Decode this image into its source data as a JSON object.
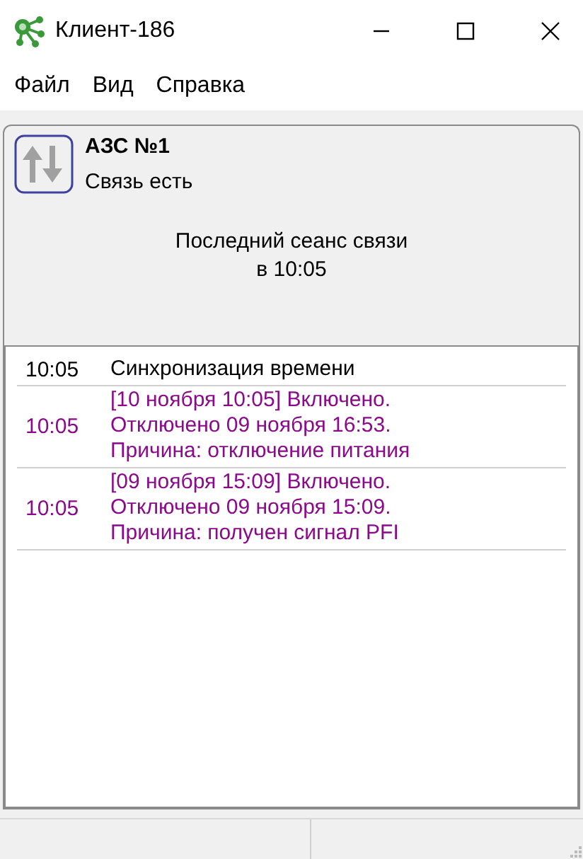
{
  "window": {
    "title": "Клиент-186"
  },
  "menu": [
    {
      "label": "Файл"
    },
    {
      "label": "Вид"
    },
    {
      "label": "Справка"
    }
  ],
  "station": {
    "name": "АЗС №1",
    "status": "Связь есть",
    "last_session": [
      "Последний сеанс связи",
      "в 10:05"
    ]
  },
  "log": [
    {
      "time": "10:05",
      "lines": [
        "Синхронизация времени"
      ],
      "color": "#000000"
    },
    {
      "time": "10:05",
      "lines": [
        "[10 ноября 10:05] Включено.",
        "Отключено 09 ноября 16:53.",
        "Причина: отключение питания"
      ],
      "color": "#8b0a8b"
    },
    {
      "time": "10:05",
      "lines": [
        "[09 ноября 15:09] Включено.",
        "Отключено 09 ноября 15:09.",
        "Причина: получен сигнал PFI"
      ],
      "color": "#8b0a8b"
    }
  ]
}
